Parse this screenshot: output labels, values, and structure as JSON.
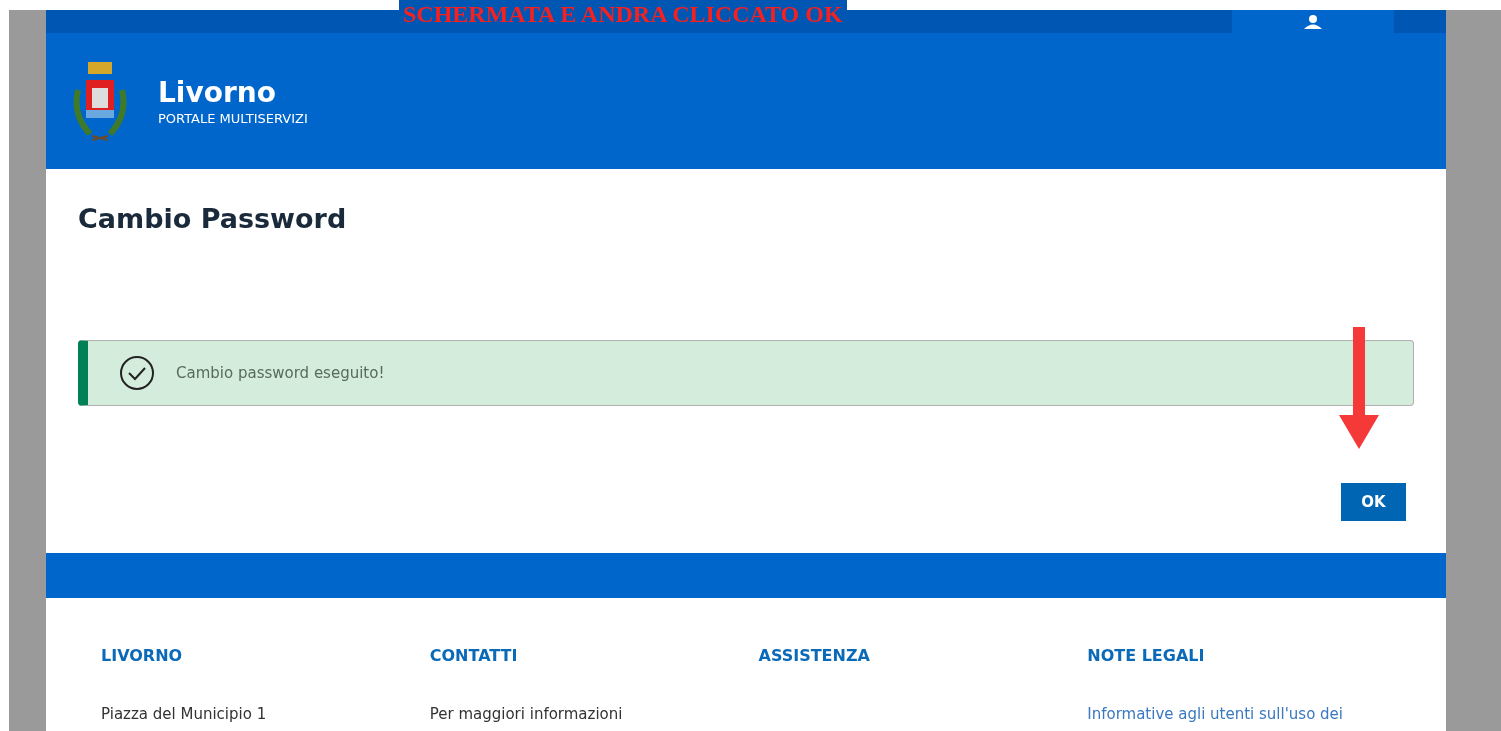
{
  "annotation": {
    "text": "SCHERMATA E ANDRA CLICCATO OK"
  },
  "header": {
    "title": "Livorno",
    "subtitle": "PORTALE MULTISERVIZI"
  },
  "page": {
    "title": "Cambio Password"
  },
  "alert": {
    "message": "Cambio password eseguito!"
  },
  "buttons": [
    "OK"
  ],
  "footer": {
    "columns": [
      {
        "heading": "LIVORNO",
        "text": "Piazza del Municipio 1",
        "kind": "plain"
      },
      {
        "heading": "CONTATTI",
        "text": "Per maggiori informazioni",
        "kind": "plain"
      },
      {
        "heading": "ASSISTENZA"
      },
      {
        "heading": "NOTE LEGALI",
        "text": "Informative agli utenti sull'uso dei",
        "kind": "link"
      }
    ]
  }
}
